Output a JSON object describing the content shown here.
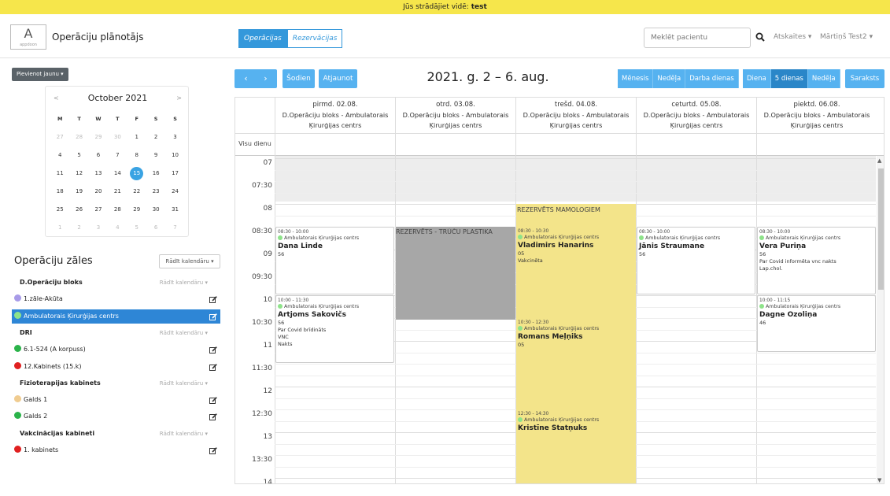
{
  "banner": {
    "prefix": "Jūs strādājiet vidē: ",
    "env": "test"
  },
  "app": {
    "logo_letter": "A",
    "logo_sub": "appdoon",
    "title": "Operāciju plānotājs"
  },
  "nav_tabs": [
    "Operācijas",
    "Rezervācijas"
  ],
  "search": {
    "placeholder": "Meklēt pacientu"
  },
  "top_menu": {
    "reports": "Atskaites ▾",
    "user": "Mārtiņš Test2 ▾"
  },
  "add_new": "Pievienot jaunu ▾",
  "mini_calendar": {
    "month": "October 2021",
    "prev": "<",
    "next": ">",
    "dow": [
      "M",
      "T",
      "W",
      "T",
      "F",
      "S",
      "S"
    ],
    "weeks": [
      [
        [
          "27",
          1
        ],
        [
          "28",
          1
        ],
        [
          "29",
          1
        ],
        [
          "30",
          1
        ],
        [
          "1",
          0
        ],
        [
          "2",
          0
        ],
        [
          "3",
          0
        ]
      ],
      [
        [
          "4",
          0
        ],
        [
          "5",
          0
        ],
        [
          "6",
          0
        ],
        [
          "7",
          0
        ],
        [
          "8",
          0
        ],
        [
          "9",
          0
        ],
        [
          "10",
          0
        ]
      ],
      [
        [
          "11",
          0
        ],
        [
          "12",
          0
        ],
        [
          "13",
          0
        ],
        [
          "14",
          0
        ],
        [
          "15",
          2
        ],
        [
          "16",
          0
        ],
        [
          "17",
          0
        ]
      ],
      [
        [
          "18",
          0
        ],
        [
          "19",
          0
        ],
        [
          "20",
          0
        ],
        [
          "21",
          0
        ],
        [
          "22",
          0
        ],
        [
          "23",
          0
        ],
        [
          "24",
          0
        ]
      ],
      [
        [
          "25",
          0
        ],
        [
          "26",
          0
        ],
        [
          "27",
          0
        ],
        [
          "28",
          0
        ],
        [
          "29",
          0
        ],
        [
          "30",
          0
        ],
        [
          "31",
          0
        ]
      ],
      [
        [
          "1",
          1
        ],
        [
          "2",
          1
        ],
        [
          "3",
          1
        ],
        [
          "4",
          1
        ],
        [
          "5",
          1
        ],
        [
          "6",
          1
        ],
        [
          "7",
          1
        ]
      ]
    ]
  },
  "rooms": {
    "title": "Operāciju zāles",
    "show_calendar": "Rādīt kalendāru ▾",
    "show_calendar_small": "Rādīt kalendāru ▾",
    "rows": [
      {
        "type": "group",
        "label": "D.Operāciju bloks"
      },
      {
        "type": "room",
        "label": "1.zāle-Akūta",
        "color": "#a89be8"
      },
      {
        "type": "room",
        "label": "Ambulatorais Ķirurģijas centrs",
        "color": "#8ee38a",
        "selected": true
      },
      {
        "type": "group",
        "label": "DRI"
      },
      {
        "type": "room",
        "label": "6.1-524 (A korpuss)",
        "color": "#2bb34a"
      },
      {
        "type": "room",
        "label": "12.Kabinets (15.k)",
        "color": "#e02020"
      },
      {
        "type": "group",
        "label": "Fizioterapijas kabinets"
      },
      {
        "type": "room",
        "label": "Galds 1",
        "color": "#f0cc90"
      },
      {
        "type": "room",
        "label": "Galds 2",
        "color": "#2bb34a"
      },
      {
        "type": "group",
        "label": "Vakcinācijas kabineti"
      },
      {
        "type": "room",
        "label": "1. kabinets",
        "color": "#e02020"
      }
    ]
  },
  "toolbar": {
    "prev": "‹",
    "next": "›",
    "today": "Šodien",
    "refresh": "Atjaunot",
    "title": "2021. g. 2 – 6. aug.",
    "views_left": [
      "Mēnesis",
      "Nedēļa",
      "Darba dienas"
    ],
    "views_right": [
      "Diena",
      "5 dienas",
      "Nedēļa"
    ],
    "list": "Saraksts"
  },
  "calendar": {
    "allday_label": "Visu dienu",
    "columns": [
      {
        "date": "pirmd. 02.08.",
        "sub1": "D.Operāciju bloks - Ambulatorais",
        "sub2": "Ķirurģijas centrs"
      },
      {
        "date": "otrd. 03.08.",
        "sub1": "D.Operāciju bloks - Ambulatorais",
        "sub2": "Ķirurģijas centrs"
      },
      {
        "date": "trešd. 04.08.",
        "sub1": "D.Operāciju bloks - Ambulatorais",
        "sub2": "Ķirurģijas centrs"
      },
      {
        "date": "ceturtd. 05.08.",
        "sub1": "D.Operāciju bloks - Ambulatorais",
        "sub2": "Ķirurģijas centrs"
      },
      {
        "date": "piektd. 06.08.",
        "sub1": "D.Operāciju bloks - Ambulatorais",
        "sub2": "Ķirurģijas centrs"
      }
    ],
    "time_labels": [
      "07",
      "07:30",
      "08",
      "08:30",
      "09",
      "09:30",
      "10",
      "10:30",
      "11",
      "11:30",
      "12",
      "12:30",
      "13",
      "13:30",
      "14"
    ],
    "reserved": [
      {
        "label": "REZERVĒTS MAMOLOGIEM"
      },
      {
        "label": "REZERVĒTS - TRŪČU PLASTIKA"
      }
    ],
    "events": [
      {
        "time": "08:30 - 10:00",
        "loc": "Ambulatorais Ķirurģijas centrs",
        "name": "Dana Linde",
        "lines": [
          "56"
        ]
      },
      {
        "time": "10:00 - 11:30",
        "loc": "Ambulatorais Ķirurģijas centrs",
        "name": "Artjoms Sakovičs",
        "lines": [
          "56",
          "Par Covid brīdināts",
          "VNC",
          "Nakts"
        ]
      },
      {
        "time": "08:30 - 10:30",
        "loc": "Ambulatorais Ķirurģijas centrs",
        "name": "Vladimirs Hanarins",
        "lines": [
          "05",
          "Vakcinēta"
        ]
      },
      {
        "time": "10:30 - 12:30",
        "loc": "Ambulatorais Ķirurģijas centrs",
        "name": "Romans Meļņiks",
        "lines": [
          "05"
        ]
      },
      {
        "time": "12:30 - 14:30",
        "loc": "Ambulatorais Ķirurģijas centrs",
        "name": "Kristīne Statņuks",
        "lines": []
      },
      {
        "time": "08:30 - 10:00",
        "loc": "Ambulatorais Ķirurģijas centrs",
        "name": "Jānis Straumane",
        "lines": [
          "56"
        ]
      },
      {
        "time": "08:30 - 10:00",
        "loc": "Ambulatorais Ķirurģijas centrs",
        "name": "Vera Puriņa",
        "lines": [
          "56",
          "Par Covid informēta vnc nakts",
          "Lap.chol."
        ]
      },
      {
        "time": "10:00 - 11:15",
        "loc": "Ambulatorais Ķirurģijas centrs",
        "name": "Dagne Ozoliņa",
        "lines": [
          "46"
        ]
      }
    ]
  },
  "colors": {
    "accent": "#3498db",
    "selected": "#2e86d6",
    "reserved_yellow": "#f3e48a",
    "reserved_gray": "#a7a7a7",
    "banner": "#f6e64b"
  }
}
